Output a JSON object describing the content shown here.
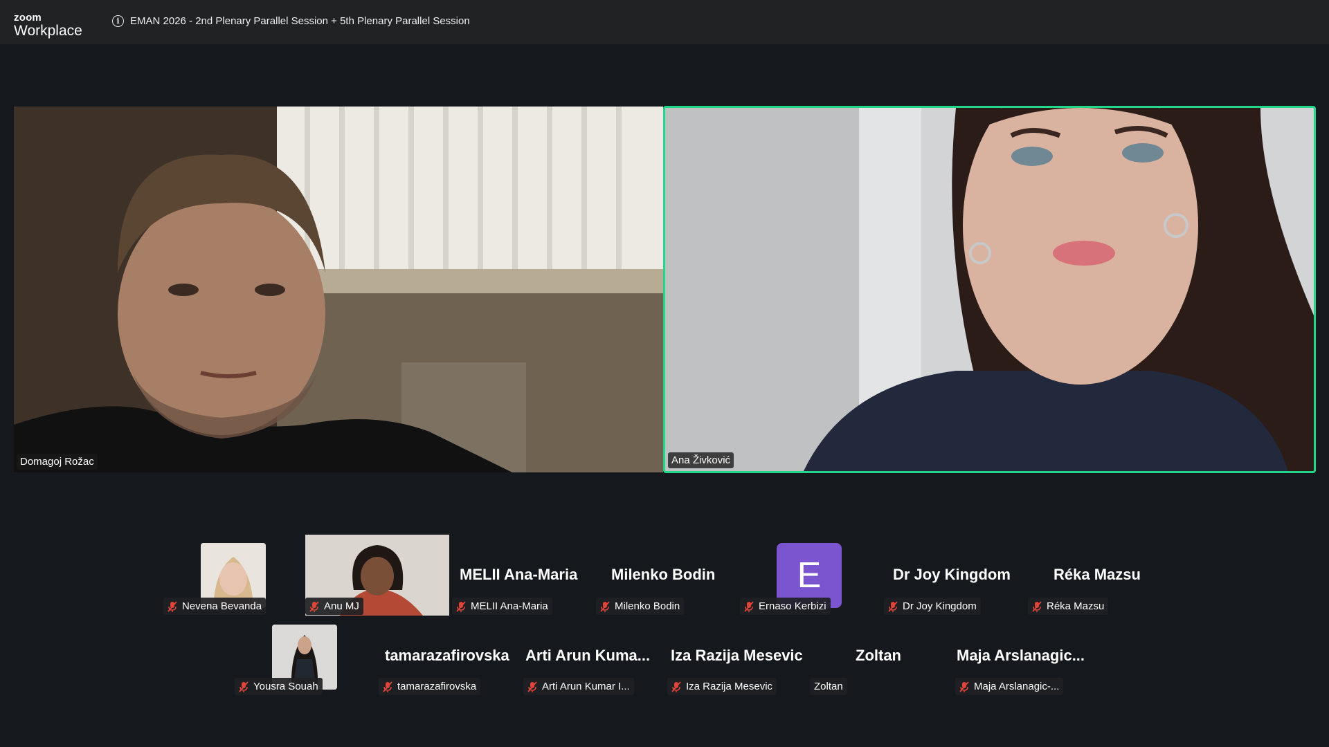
{
  "app": {
    "logo_small": "zoom",
    "logo_big": "Workplace"
  },
  "meeting": {
    "title": "EMAN 2026 - 2nd Plenary Parallel Session + 5th Plenary Parallel Session",
    "info_icon": "info-icon"
  },
  "main_videos": [
    {
      "name": "Domagoj Rožac",
      "active_speaker": false
    },
    {
      "name": "Ana Živković",
      "active_speaker": true
    }
  ],
  "gallery": {
    "row1": [
      {
        "name": "Nevena Bevanda",
        "display": "",
        "muted": true,
        "video": true
      },
      {
        "name": "Anu MJ",
        "display": "",
        "muted": true,
        "video": true
      },
      {
        "name": "MELII Ana-Maria",
        "display": "MELII Ana-Maria",
        "muted": true,
        "video": false
      },
      {
        "name": "Milenko Bodin",
        "display": "Milenko Bodin",
        "muted": true,
        "video": false
      },
      {
        "name": "Ernaso Kerbizi",
        "display": "E",
        "muted": true,
        "video": false
      },
      {
        "name": "Dr Joy Kingdom",
        "display": "Dr Joy Kingdom",
        "muted": true,
        "video": false
      },
      {
        "name": "Réka Mazsu",
        "display": "Réka Mazsu",
        "muted": true,
        "video": false
      }
    ],
    "row2": [
      {
        "name": "Yousra Souah",
        "display": "",
        "muted": true,
        "video": true
      },
      {
        "name": "tamarazafirovska",
        "display": "tamarazafirovska",
        "muted": true,
        "video": false
      },
      {
        "name": "Arti Arun Kumar I...",
        "display": "Arti Arun Kuma...",
        "muted": true,
        "video": false
      },
      {
        "name": "Iza Razija Mesevic",
        "display": "Iza Razija Mesevic",
        "muted": true,
        "video": false
      },
      {
        "name": "Zoltan",
        "display": "Zoltan",
        "muted": false,
        "video": false
      },
      {
        "name": "Maja Arslanagic-...",
        "display": "Maja  Arslanagic...",
        "muted": true,
        "video": false
      }
    ]
  },
  "colors": {
    "active_speaker_border": "#22d68a",
    "avatar_e": "#7b55d0",
    "muted_icon": "#e0453a",
    "background": "#15181c",
    "titlebar": "#212223"
  }
}
